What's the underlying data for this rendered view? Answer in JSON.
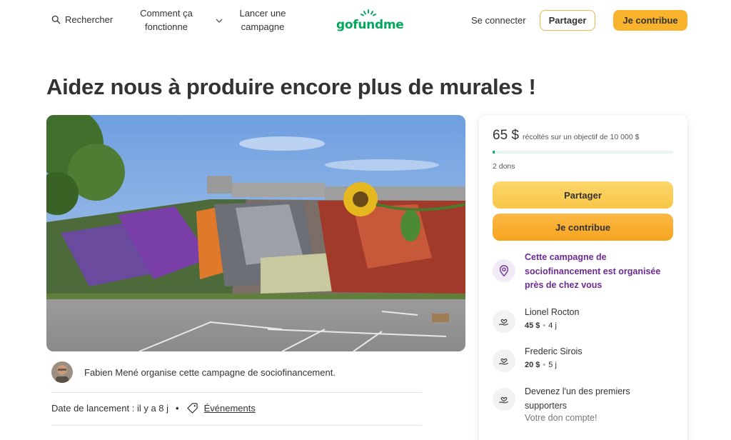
{
  "header": {
    "search_label": "Rechercher",
    "how_it_works_label": "Comment ça fonctionne",
    "launch_label": "Lancer une campagne",
    "logo_text": "gofundme",
    "signin_label": "Se connecter",
    "share_label": "Partager",
    "donate_label": "Je contribue"
  },
  "campaign": {
    "title": "Aidez nous à produire encore plus de murales !",
    "organizer_text": "Fabien Mené organise cette campagne de sociofinancement.",
    "launch_date": "Date de lancement : il y a 8 j",
    "events_label": "Événements"
  },
  "card": {
    "raised_amount": "65 $",
    "raised_goal_text": "récoltés sur un objectif de 10 000 $",
    "progress_fraction": 0.0065,
    "donors_count": "2 dons",
    "share_label": "Partager",
    "donate_label": "Je contribue",
    "nearby_text": "Cette campagne de sociofinancement est organisée près de chez vous",
    "donations": [
      {
        "name": "Lionel Rocton",
        "amount": "45 $",
        "time": "4 j"
      },
      {
        "name": "Frederic Sirois",
        "amount": "20 $",
        "time": "5 j"
      }
    ],
    "first_supporters_text": "Devenez l'un des premiers supporters",
    "first_supporters_sub": "Votre don compte!"
  },
  "colors": {
    "brand_green": "#02a95c",
    "accent_yellow": "#f9b22c",
    "nearby_purple": "#6b2c91"
  }
}
